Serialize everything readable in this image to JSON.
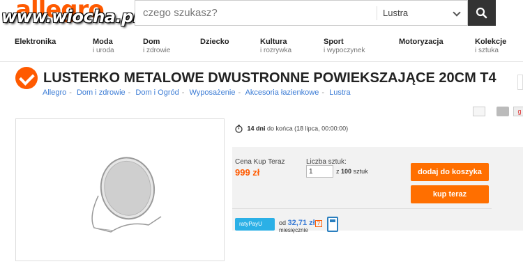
{
  "header": {
    "logo": "allegro",
    "watermark": "www.wiocha.pl",
    "search_placeholder": "czego szukasz?",
    "category_selected": "Lustra"
  },
  "nav": [
    {
      "main": "Elektronika",
      "sub": ""
    },
    {
      "main": "Moda",
      "sub": "i uroda"
    },
    {
      "main": "Dom",
      "sub": "i zdrowie"
    },
    {
      "main": "Dziecko",
      "sub": ""
    },
    {
      "main": "Kultura",
      "sub": "i rozrywka"
    },
    {
      "main": "Sport",
      "sub": "i wypoczynek"
    },
    {
      "main": "Motoryzacja",
      "sub": ""
    },
    {
      "main": "Kolekcje",
      "sub": "i sztuka"
    }
  ],
  "product": {
    "title": "LUSTERKO METALOWE DWUSTRONNE POWIEKSZAJĄCE 20CM T4"
  },
  "breadcrumb": [
    "Allegro",
    "Dom i zdrowie",
    "Dom i Ogród",
    "Wyposażenie",
    "Akcesoria łazienkowe",
    "Lustra"
  ],
  "timer": {
    "days": "14 dni",
    "rest": "do końca (18 lipca, 00:00:00)"
  },
  "buy": {
    "price_label": "Cena Kup Teraz",
    "price": "999 zł",
    "qty_label": "Liczba sztuk:",
    "qty_value": "1",
    "qty_of_prefix": "z",
    "qty_max": "100",
    "qty_unit": "sztuk",
    "add_to_cart": "dodaj do koszyka",
    "buy_now": "kup teraz"
  },
  "installments": {
    "logo": "ratyPayU",
    "prefix": "od",
    "amount": "32,71 zł",
    "help": "?",
    "period": "miesięcznie"
  },
  "colors": {
    "accent": "#ff5a00",
    "button": "#ff6f00",
    "link": "#3a7bd5"
  }
}
